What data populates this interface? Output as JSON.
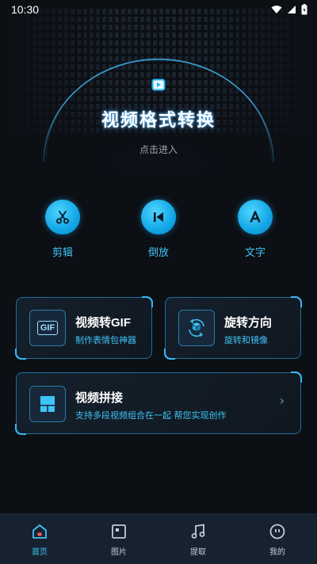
{
  "status_bar": {
    "time": "10:30"
  },
  "hero": {
    "title": "视频格式转换",
    "subtitle": "点击进入"
  },
  "actions": [
    {
      "label": "剪辑",
      "icon": "scissors-icon"
    },
    {
      "label": "倒放",
      "icon": "skip-back-icon"
    },
    {
      "label": "文字",
      "icon": "letter-a-icon"
    }
  ],
  "cards": {
    "gif": {
      "title": "视频转GIF",
      "subtitle": "制作表情包神器",
      "icon_text": "GIF"
    },
    "rotate": {
      "title": "旋转方向",
      "subtitle": "旋转和镜像"
    },
    "merge": {
      "title": "视频拼接",
      "subtitle": "支持多段视频组合在一起 帮您实现创作",
      "chevron": "›"
    }
  },
  "tabs": [
    {
      "label": "首页",
      "active": true
    },
    {
      "label": "图片",
      "active": false
    },
    {
      "label": "提取",
      "active": false
    },
    {
      "label": "我的",
      "active": false
    }
  ],
  "colors": {
    "accent": "#3fc4f7",
    "background": "#0c0f14",
    "tabbar": "#172230",
    "card_border": "#1f6e9c"
  }
}
